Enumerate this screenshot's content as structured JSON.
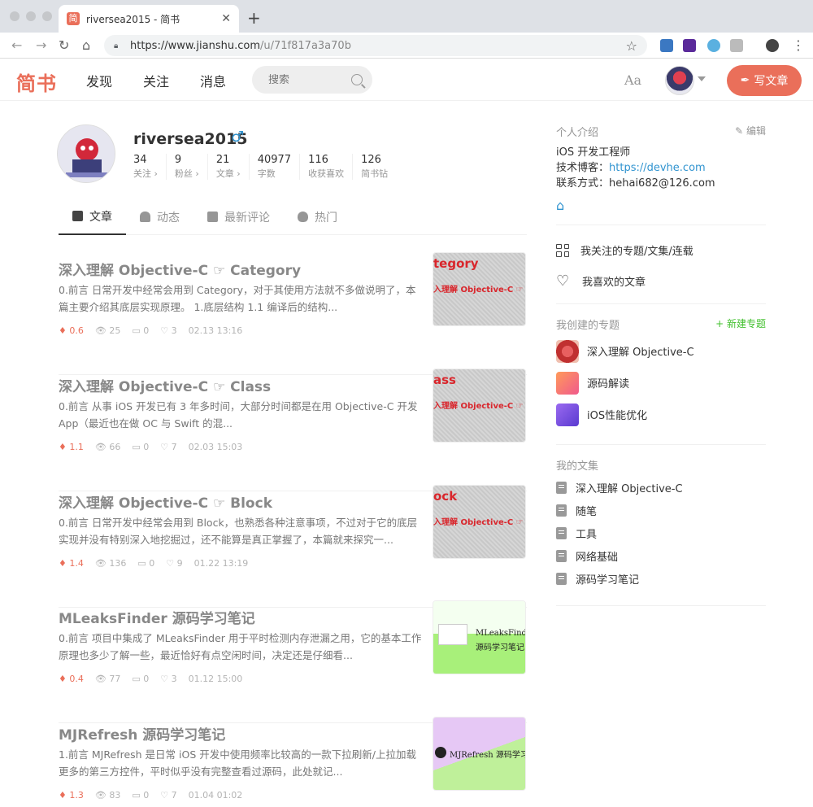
{
  "browser": {
    "tab_title": "riversea2015 - 简书",
    "favicon": "简",
    "url_host": "https://www.jianshu.com",
    "url_path": "/u/71f817a3a70b"
  },
  "header": {
    "logo": "简书",
    "nav": [
      "发现",
      "关注",
      "消息"
    ],
    "search_placeholder": "搜索",
    "font_btn": "Aa",
    "write_btn": "写文章",
    "accent": "#ea6f5a"
  },
  "profile": {
    "name": "riversea2015",
    "gender_icon": "♂",
    "stats": [
      {
        "num": "34",
        "label": "关注 ›"
      },
      {
        "num": "9",
        "label": "粉丝 ›"
      },
      {
        "num": "21",
        "label": "文章 ›"
      },
      {
        "num": "40977",
        "label": "字数"
      },
      {
        "num": "116",
        "label": "收获喜欢"
      },
      {
        "num": "126",
        "label": "简书钻"
      }
    ]
  },
  "tabs": [
    {
      "label": "文章",
      "icon": "document-icon"
    },
    {
      "label": "动态",
      "icon": "bell-icon"
    },
    {
      "label": "最新评论",
      "icon": "comments-icon"
    },
    {
      "label": "热门",
      "icon": "fire-icon"
    }
  ],
  "articles": [
    {
      "title": "深入理解 Objective-C ☞ Category",
      "abstract": "0.前言 日常开发中经常会用到 Category，对于其使用方法就不多做说明了，本篇主要介绍其底层实现原理。 1.底层结构 1.1 编译后的结构...",
      "diamond": "0.6",
      "views": "25",
      "comments": "0",
      "likes": "3",
      "time": "02.13 13:16",
      "thumb_t1": "tegory",
      "thumb_t2": "入理解 Objective-C ☞ Categ"
    },
    {
      "title": "深入理解 Objective-C ☞ Class",
      "abstract": "0.前言 从事 iOS 开发已有 3 年多时间，大部分时间都是在用 Objective-C 开发 App（最近也在做 OC 与 Swift 的混...",
      "diamond": "1.1",
      "views": "66",
      "comments": "0",
      "likes": "7",
      "time": "02.03 15:03",
      "thumb_t1": "ass",
      "thumb_t2": "入理解 Objective-C ☞ Clas"
    },
    {
      "title": "深入理解 Objective-C ☞ Block",
      "abstract": "0.前言 日常开发中经常会用到 Block，也熟悉各种注意事项，不过对于它的底层实现并没有特别深入地挖掘过，还不能算是真正掌握了，本篇就来探究一...",
      "diamond": "1.4",
      "views": "136",
      "comments": "0",
      "likes": "9",
      "time": "01.22 13:19",
      "thumb_t1": "ock",
      "thumb_t2": "入理解 Objective-C ☞ Bloc"
    },
    {
      "title": "MLeaksFinder 源码学习笔记",
      "abstract": "0.前言 项目中集成了 MLeaksFinder 用于平时检测内存泄漏之用，它的基本工作原理也多少了解一些，最近恰好有点空闲时间，决定还是仔细看...",
      "diamond": "0.4",
      "views": "77",
      "comments": "0",
      "likes": "3",
      "time": "01.12 15:00",
      "thumb_t1": "MLeaksFinder",
      "thumb_t2": "源码学习笔记"
    },
    {
      "title": "MJRefresh 源码学习笔记",
      "abstract": "1.前言 MJRefresh 是日常 iOS 开发中使用频率比较高的一款下拉刷新/上拉加载更多的第三方控件，平时似乎没有完整查看过源码，此处就记...",
      "diamond": "1.3",
      "views": "83",
      "comments": "0",
      "likes": "7",
      "time": "01.04 01:02",
      "thumb_t1": "MJRefresh 源码学习笔记"
    }
  ],
  "sidebar": {
    "intro_title": "个人介绍",
    "edit": "编辑",
    "intro_line1": "iOS 开发工程师",
    "intro_blog_label": "技术博客：",
    "intro_blog_link": "https://devhe.com",
    "intro_contact": "联系方式：hehai682@126.com",
    "followed": "我关注的专题/文集/连载",
    "liked": "我喜欢的文章",
    "created_title": "我创建的专题",
    "new_collection": "+ 新建专题",
    "collections": [
      "深入理解 Objective-C",
      "源码解读",
      "iOS性能优化"
    ],
    "notebooks_title": "我的文集",
    "notebooks": [
      "深入理解 Objective-C",
      "随笔",
      "工具",
      "网络基础",
      "源码学习笔记"
    ]
  }
}
